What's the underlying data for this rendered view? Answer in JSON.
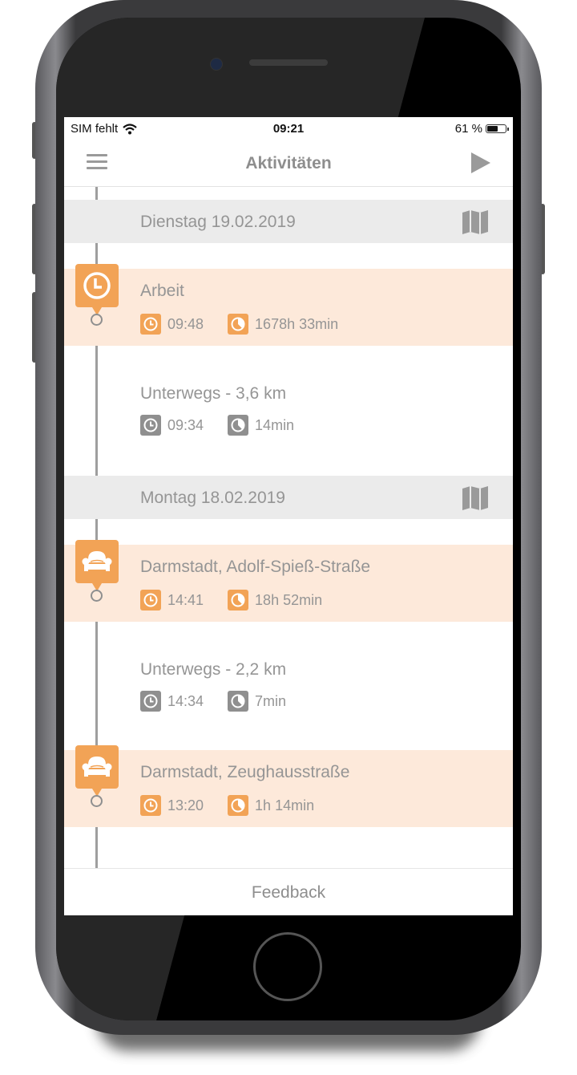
{
  "status_bar": {
    "carrier": "SIM fehlt",
    "time": "09:21",
    "battery": "61 %",
    "battery_level": 0.61
  },
  "nav": {
    "title": "Aktivitäten",
    "menu_icon": "hamburger-menu-icon",
    "play_icon": "play-icon"
  },
  "accent_color": "#f2a356",
  "days": [
    {
      "label": "Dienstag 19.02.2019",
      "entries": [
        {
          "type": "stay",
          "icon": "clock-icon",
          "title": "Arbeit",
          "start": "09:48",
          "duration": "1678h 33min"
        },
        {
          "type": "move",
          "title": "Unterwegs - 3,6 km",
          "start": "09:34",
          "duration": "14min"
        }
      ]
    },
    {
      "label": "Montag 18.02.2019",
      "entries": [
        {
          "type": "stay",
          "icon": "armchair-icon",
          "title": "Darmstadt, Adolf-Spieß-Straße",
          "start": "14:41",
          "duration": "18h 52min"
        },
        {
          "type": "move",
          "title": "Unterwegs - 2,2 km",
          "start": "14:34",
          "duration": "7min"
        },
        {
          "type": "stay",
          "icon": "armchair-icon",
          "title": "Darmstadt, Zeughausstraße",
          "start": "13:20",
          "duration": "1h 14min"
        }
      ]
    }
  ],
  "footer": {
    "label": "Feedback"
  }
}
